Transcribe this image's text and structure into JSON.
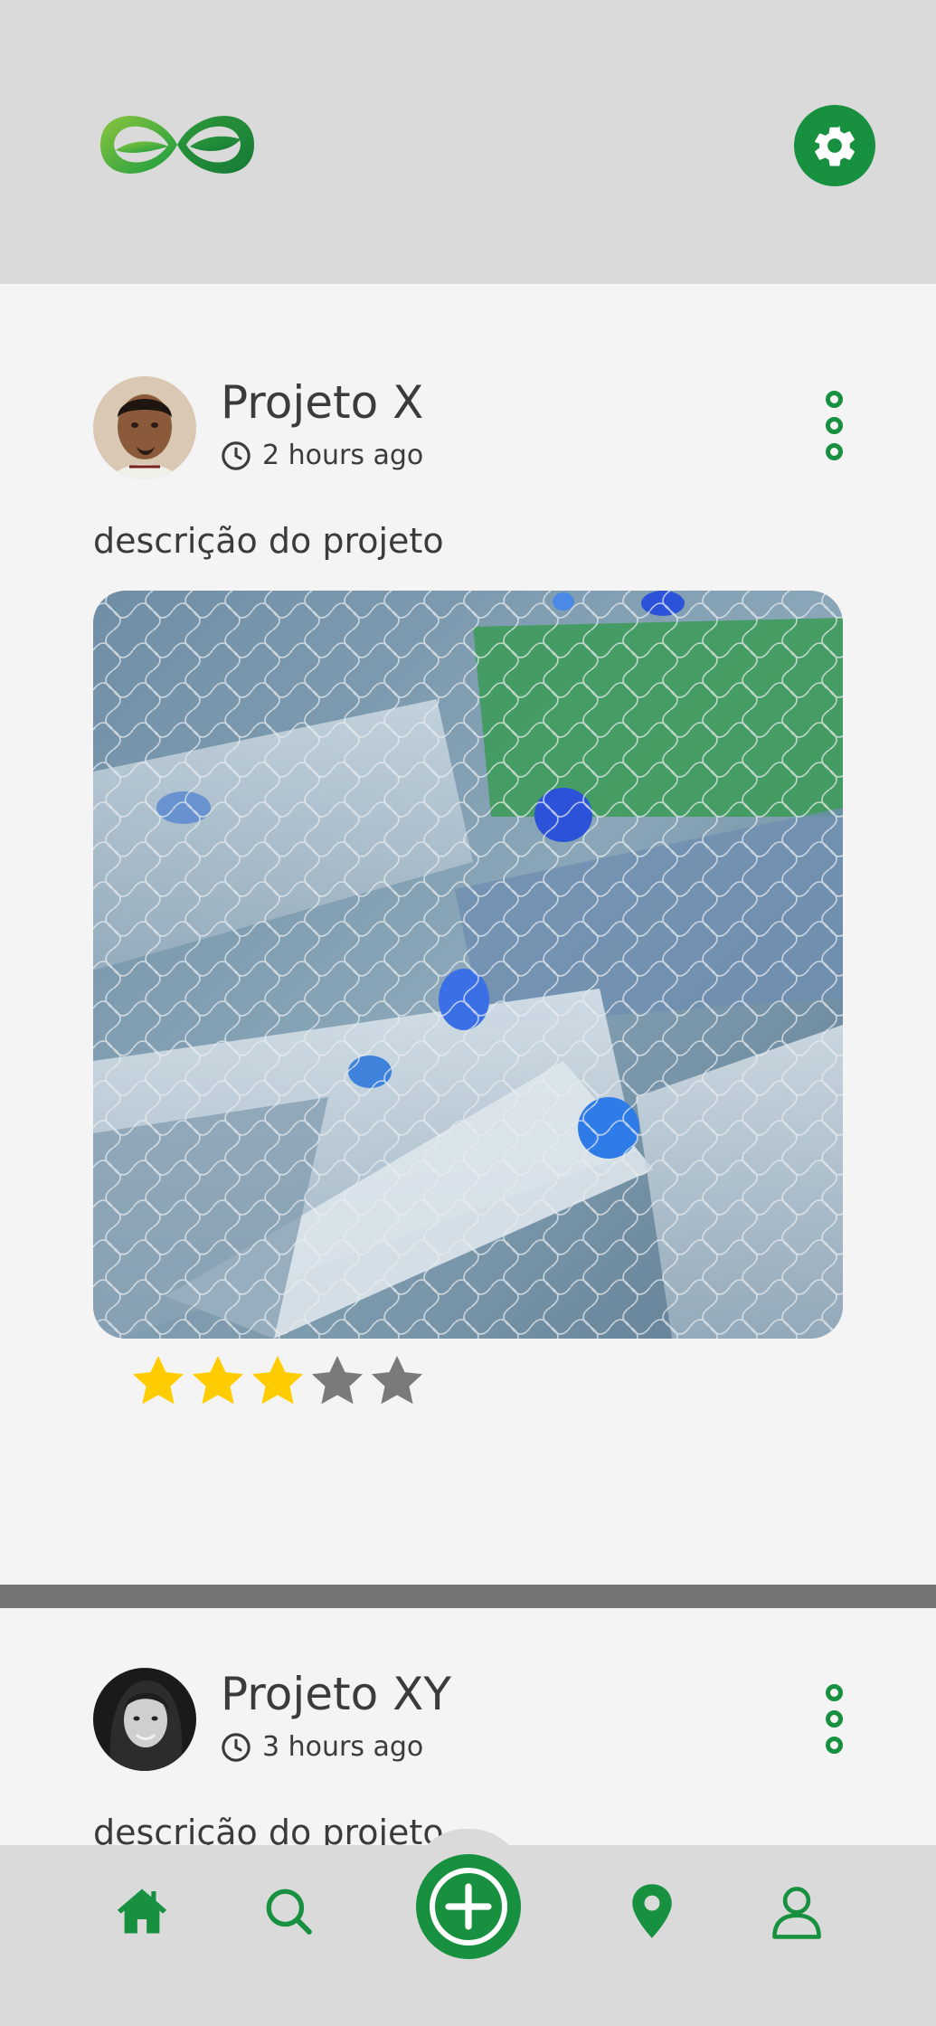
{
  "header": {
    "logo_name": "infinity-leaf-logo",
    "settings_icon": "gear-icon"
  },
  "posts": [
    {
      "title": "Projeto X",
      "time": "2 hours ago",
      "description": "descrição do projeto",
      "rating": 3,
      "max_rating": 5,
      "image": "plastic-bottles-in-net"
    },
    {
      "title": "Projeto XY",
      "time": "3 hours ago",
      "description": "descrição do projeto"
    }
  ],
  "nav": {
    "items": [
      "home-icon",
      "search-icon",
      "add-icon",
      "location-icon",
      "profile-icon"
    ]
  },
  "colors": {
    "brand_green": "#17903f",
    "star_filled": "#ffcc00",
    "star_empty": "#7a7a7a",
    "header_bg": "#dadada",
    "content_bg": "#f4f4f4"
  }
}
